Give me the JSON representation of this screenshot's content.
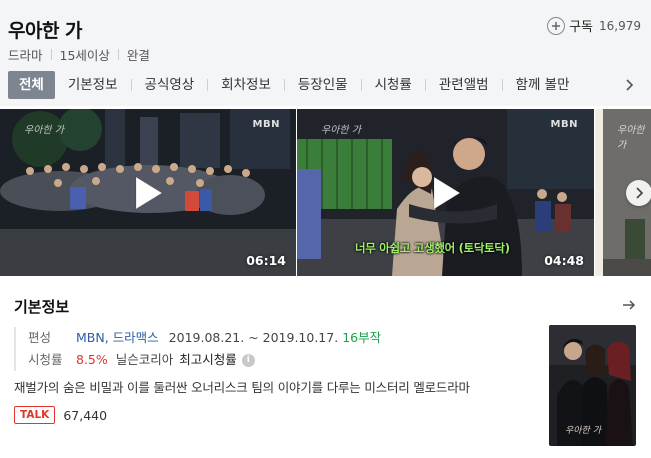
{
  "header": {
    "title": "우아한 가",
    "subscribe_label": "구독",
    "subscriber_count": "16,979",
    "meta": [
      "드라마",
      "15세이상",
      "완결"
    ]
  },
  "tabs": [
    "전체",
    "기본정보",
    "공식영상",
    "회차정보",
    "등장인물",
    "시청률",
    "관련앨범",
    "함께 볼만"
  ],
  "active_tab": "전체",
  "videos": [
    {
      "duration": "06:14",
      "channel": "MBN",
      "watermark": "우아한 가"
    },
    {
      "duration": "04:48",
      "channel": "MBN",
      "watermark": "우아한 가",
      "caption": "너무 아쉽고 고생했어 (토닥토닥)"
    },
    {
      "watermark": "우아한 가"
    }
  ],
  "info": {
    "section_title": "기본정보",
    "broadcast_label": "편성",
    "broadcaster": "MBN, 드라맥스",
    "dates": "2019.08.21. ~ 2019.10.17.",
    "episodes": "16부작",
    "rating_label": "시청률",
    "rating_value": "8.5%",
    "rating_source": "닐슨코리아",
    "rating_note": "최고시청률",
    "description": "재벌가의 숨은 비밀과 이를 둘러싼 오너리스크 팀의 이야기를 다루는 미스터리 멜로드라마",
    "talk_badge": "TALK",
    "talk_count": "67,440",
    "poster_title": "우아한 가"
  },
  "colors": {
    "active_tab_bg": "#7d8590",
    "link": "#2c5ea6",
    "green": "#1aa24c",
    "red": "#e4352b"
  }
}
